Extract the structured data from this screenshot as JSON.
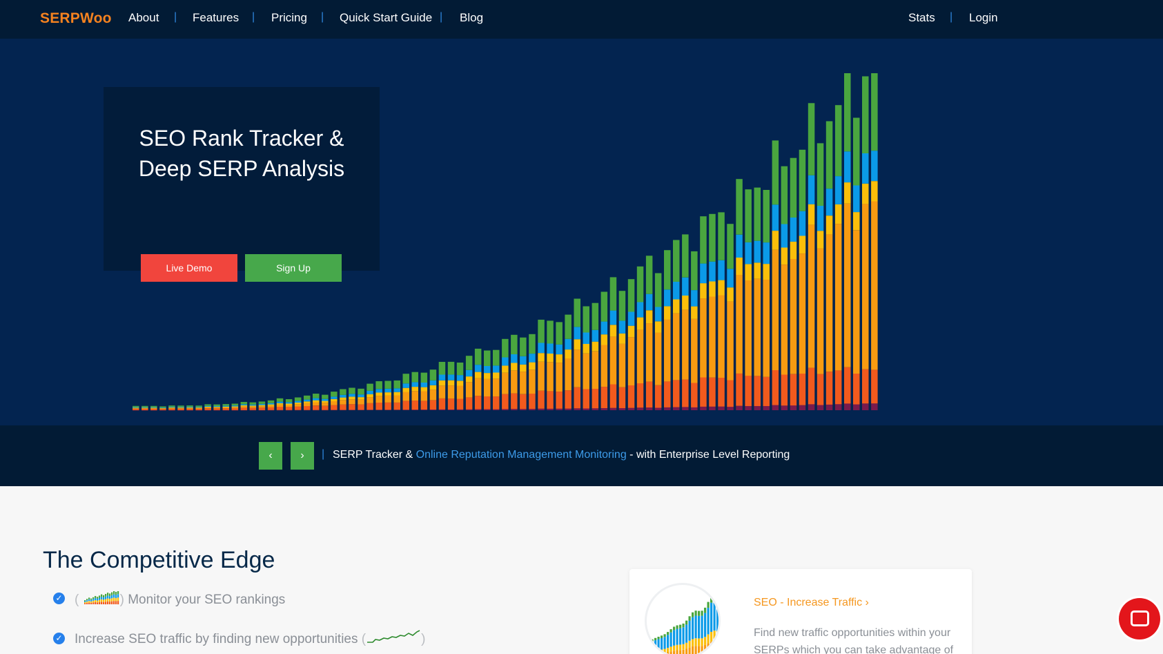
{
  "nav": {
    "logo": "SERPWoo",
    "items": [
      "About",
      "Features",
      "Pricing",
      "Quick Start Guide",
      "Blog"
    ],
    "right_items": [
      "Stats",
      "Login"
    ],
    "separator": "|"
  },
  "hero": {
    "title_line1": "SEO Rank Tracker &",
    "title_line2": "Deep SERP Analysis",
    "demo_button": "Live Demo",
    "signup_button": "Sign Up"
  },
  "subbar": {
    "prev": "‹",
    "next": "›",
    "separator": "|",
    "text_before": "SERP Tracker & ",
    "link": "Online Reputation Management Monitoring",
    "text_after": " - with Enterprise Level Reporting"
  },
  "content": {
    "heading": "The Competitive Edge",
    "features": [
      {
        "open": "(",
        "close": ")",
        "text": "Monitor your SEO rankings"
      },
      {
        "open": "(",
        "close": ")",
        "text": "Increase SEO traffic by finding new opportunities"
      }
    ],
    "card_title": "SEO - Increase Traffic ›",
    "card_body": "Find new traffic opportunities within your SERPs which you can take advantage of"
  },
  "colors": {
    "nav_bg": "#021b35",
    "hero_bg": "#032450",
    "logo": "#f5821f",
    "demo": "#f1453d",
    "signup": "#47a84b",
    "link": "#3d9be9",
    "green": "#4aa63f",
    "blue": "#0b9ae8",
    "yellow": "#fbbf0a",
    "orange": "#f89b11",
    "red": "#f25a1d",
    "purple": "#7a1a4d"
  },
  "icons": {
    "check": "check-circle-icon",
    "chat": "chat-bubble-icon",
    "prev": "chevron-left-icon",
    "next": "chevron-right-icon"
  }
}
